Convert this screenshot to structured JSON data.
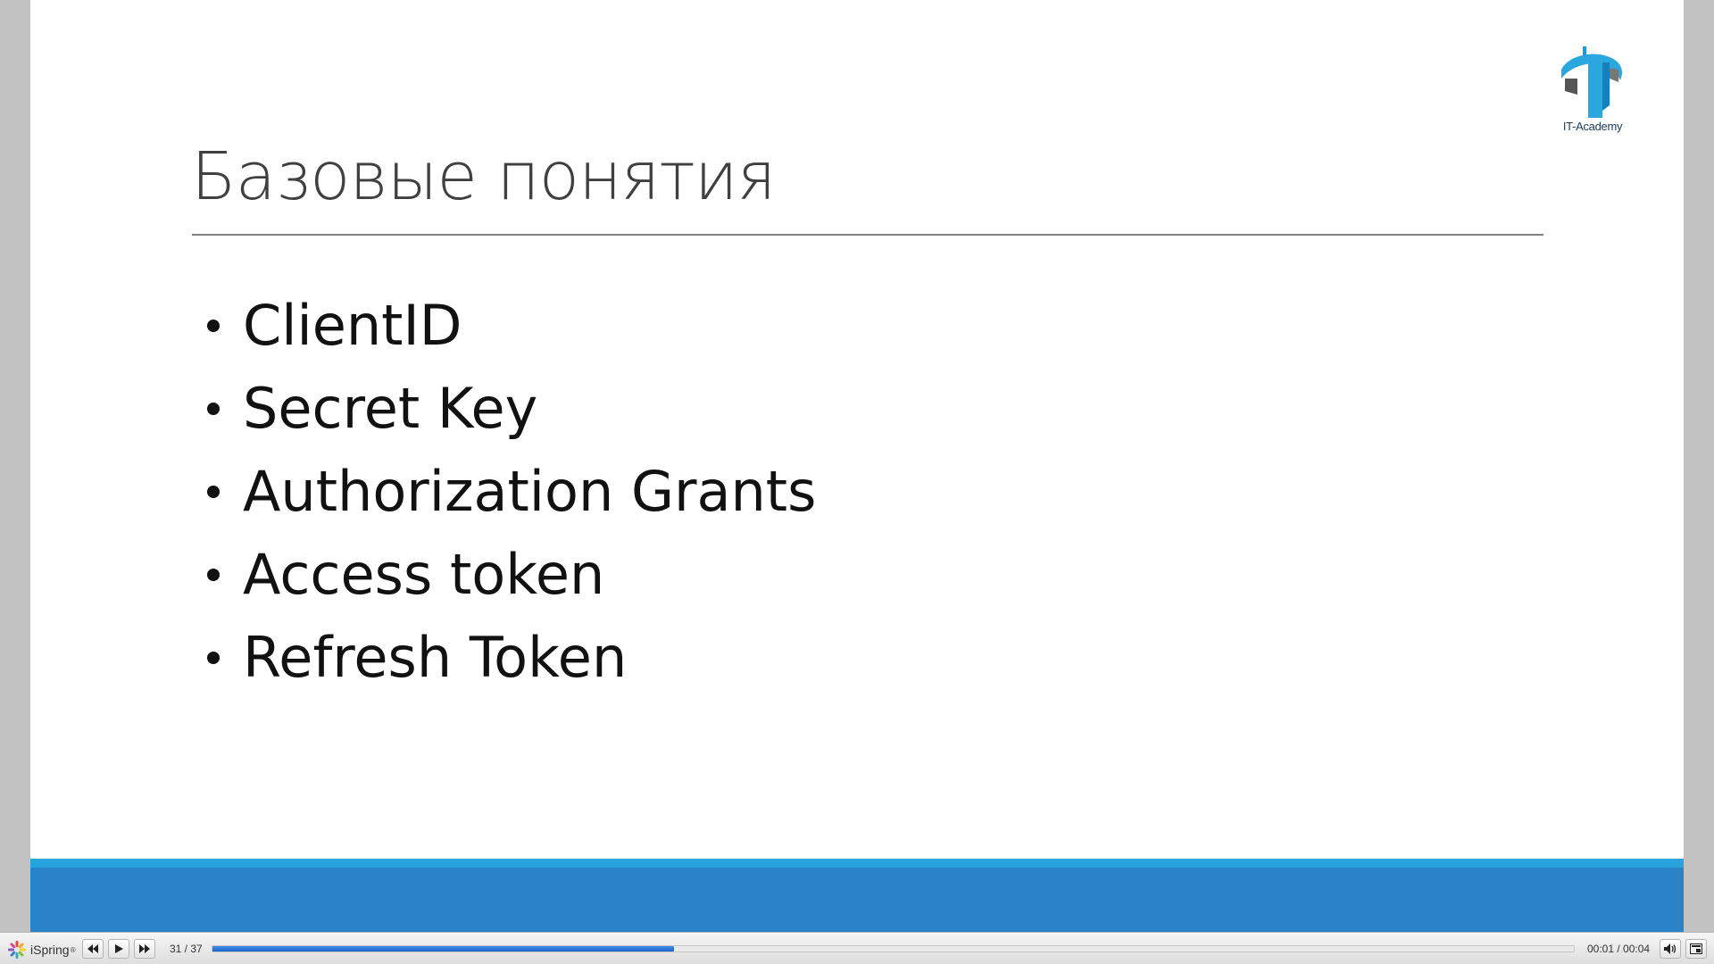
{
  "slide": {
    "title": "Базовые понятия",
    "bullets": [
      "ClientID",
      "Secret Key",
      "Authorization Grants",
      "Access token",
      "Refresh Token"
    ],
    "logo": {
      "caption": "IT-Academy",
      "icon": "it-academy-logo"
    }
  },
  "player": {
    "brand": "iSpring",
    "brand_mark": "®",
    "controls": {
      "prev_icon": "rewind-icon",
      "play_icon": "play-icon",
      "next_icon": "fast-forward-icon",
      "volume_icon": "volume-icon",
      "fullscreen_icon": "fullscreen-icon"
    },
    "slide_counter": "31 / 37",
    "time": "00:01 / 00:04",
    "progress_fraction": 0.339
  },
  "colors": {
    "band_light": "#29a3dd",
    "band_dark": "#2a83c8",
    "progress": "#1d62c8",
    "title": "#404040"
  }
}
